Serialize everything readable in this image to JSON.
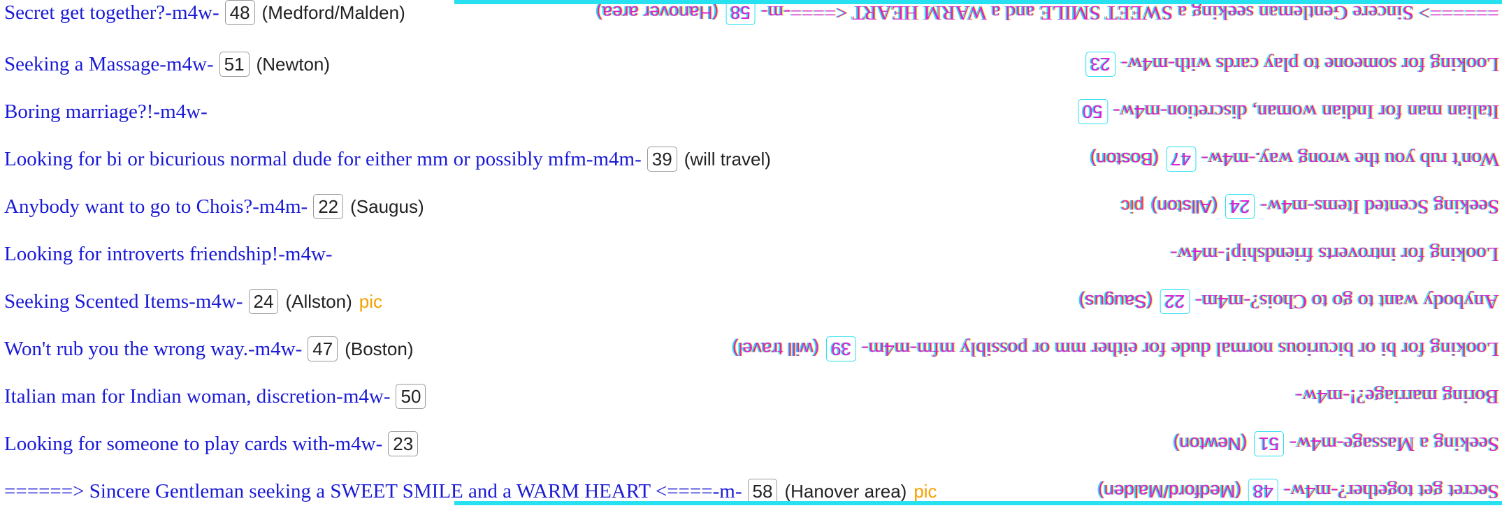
{
  "listings": [
    {
      "title": "Secret get together?",
      "sep1": " - ",
      "category": "m4w",
      "sep2": " - ",
      "age": "48",
      "location": "(Medford/Malden)",
      "pic": ""
    },
    {
      "title": "Seeking a Massage",
      "sep1": " - ",
      "category": "m4w",
      "sep2": " - ",
      "age": "51",
      "location": "(Newton)",
      "pic": ""
    },
    {
      "title": "Boring marriage?!",
      "sep1": " - ",
      "category": "m4w",
      "sep2": " - ",
      "age": "",
      "location": "",
      "pic": ""
    },
    {
      "title": "Looking for bi or bicurious normal dude for either mm or possibly mfm",
      "sep1": " - ",
      "category": "m4m",
      "sep2": " - ",
      "age": "39",
      "location": "(will travel)",
      "pic": ""
    },
    {
      "title": "Anybody want to go to Chois?",
      "sep1": " - ",
      "category": "m4m",
      "sep2": " - ",
      "age": "22",
      "location": "(Saugus)",
      "pic": ""
    },
    {
      "title": "Looking for introverts friendship!",
      "sep1": " - ",
      "category": "m4w",
      "sep2": " - ",
      "age": "",
      "location": "",
      "pic": ""
    },
    {
      "title": "Seeking Scented Items",
      "sep1": " - ",
      "category": "m4w",
      "sep2": " - ",
      "age": "24",
      "location": "(Allston)",
      "pic": "pic"
    },
    {
      "title": "Won't rub you the wrong way.",
      "sep1": " - ",
      "category": "m4w",
      "sep2": " - ",
      "age": "47",
      "location": "(Boston)",
      "pic": ""
    },
    {
      "title": "Italian man for Indian woman, discretion",
      "sep1": " - ",
      "category": "m4w",
      "sep2": " - ",
      "age": "50",
      "location": "",
      "pic": ""
    },
    {
      "title": "Looking for someone to play cards with",
      "sep1": " - ",
      "category": "m4w",
      "sep2": " - ",
      "age": "23",
      "location": "",
      "pic": ""
    },
    {
      "title": "======> Sincere Gentleman seeking a SWEET SMILE and a WARM HEART <====",
      "sep1": " - ",
      "category": "m",
      "sep2": " - ",
      "age": "58",
      "location": "(Hanover area)",
      "pic": "pic"
    }
  ],
  "colors": {
    "link": "#1a1ad6",
    "pic": "#f5a000",
    "glitch_magenta": "#e01fd0",
    "glitch_cyan": "#27e0f0",
    "glitch_yellow": "#ffe300"
  }
}
